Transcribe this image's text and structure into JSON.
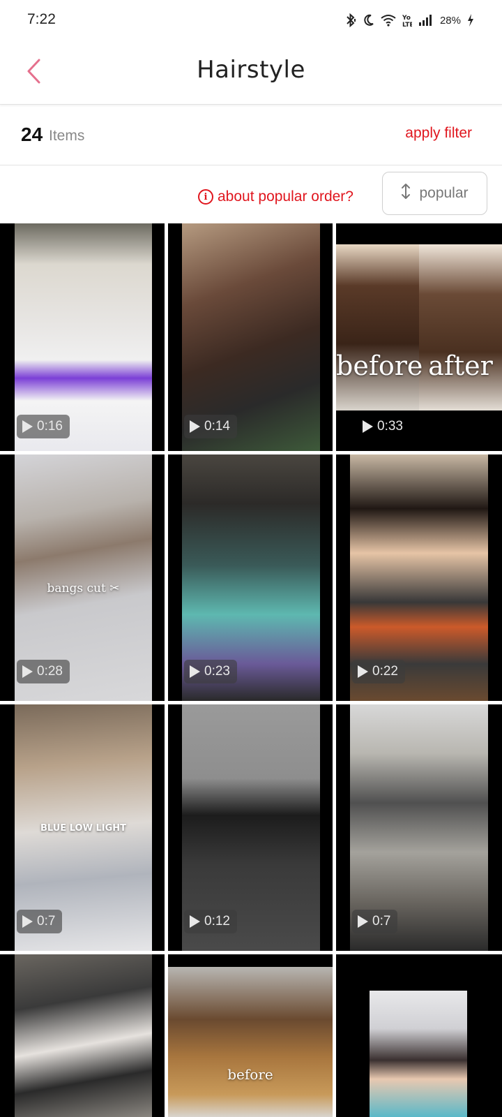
{
  "status_bar": {
    "time": "7:22",
    "battery": "28%",
    "icons": [
      "bluetooth-icon",
      "moon-icon",
      "wifi-icon",
      "volte-icon",
      "signal-icon",
      "battery-charging-icon"
    ]
  },
  "header": {
    "title": "Hairstyle",
    "back_icon": "chevron-left-icon"
  },
  "results": {
    "count": "24",
    "count_label": "Items",
    "apply_filter": "apply filter"
  },
  "sort": {
    "about_label": "about popular order?",
    "sort_label": "popular",
    "accent_color": "#e0161e"
  },
  "videos": [
    {
      "duration": "0:16",
      "overlay": ""
    },
    {
      "duration": "0:14",
      "overlay": ""
    },
    {
      "duration": "0:33",
      "overlay_before": "before",
      "overlay_after": "after"
    },
    {
      "duration": "0:28",
      "overlay": "bangs cut ✂"
    },
    {
      "duration": "0:23",
      "overlay": ""
    },
    {
      "duration": "0:22",
      "overlay": ""
    },
    {
      "duration": "0:7",
      "overlay": "BLUE LOW LIGHT"
    },
    {
      "duration": "0:12",
      "overlay": ""
    },
    {
      "duration": "0:7",
      "overlay": ""
    },
    {
      "duration": "",
      "overlay": ""
    },
    {
      "duration": "",
      "overlay": "before"
    },
    {
      "duration": "",
      "overlay": ""
    }
  ]
}
